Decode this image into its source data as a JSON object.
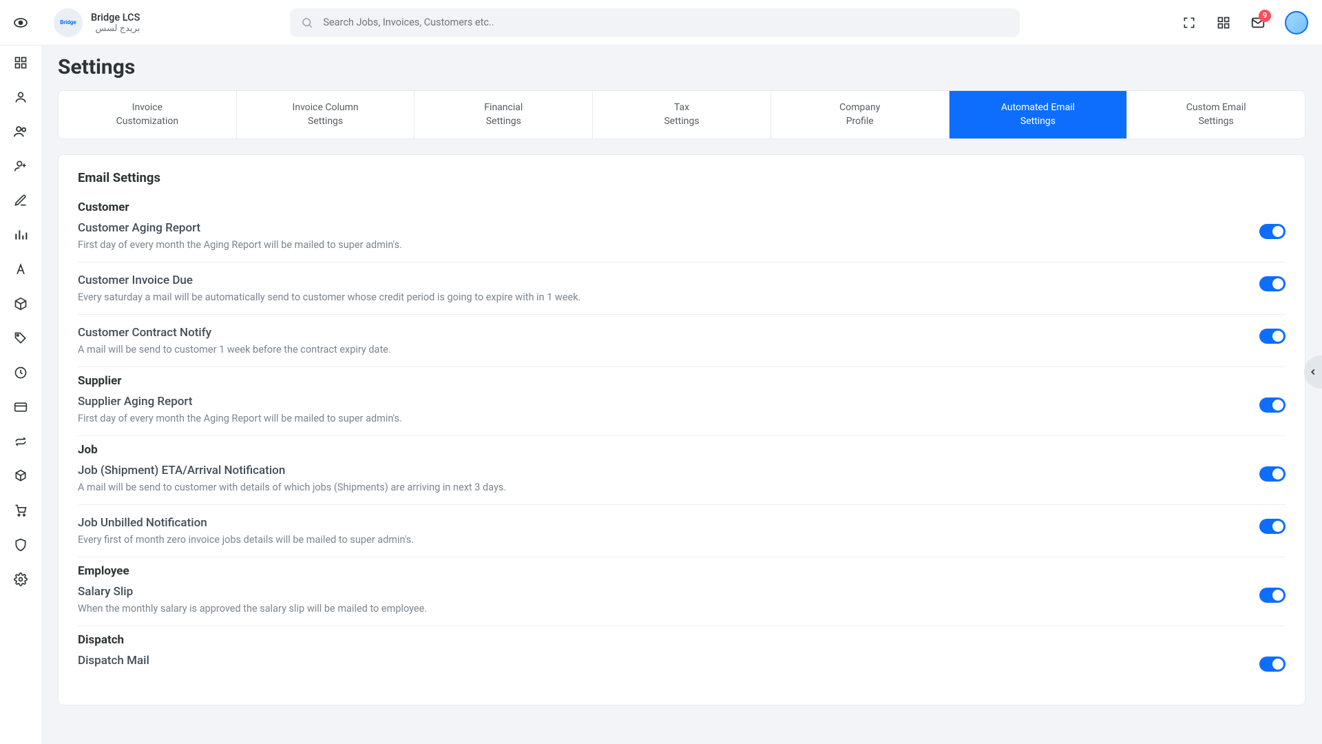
{
  "header": {
    "brand_name": "Bridge LCS",
    "brand_sub": "بريدج لسس",
    "search_placeholder": "Search Jobs, Invoices, Customers etc..",
    "notif_count": "9"
  },
  "page_title": "Settings",
  "tabs": [
    {
      "l1": "Invoice",
      "l2": "Customization"
    },
    {
      "l1": "Invoice Column",
      "l2": "Settings"
    },
    {
      "l1": "Financial",
      "l2": "Settings"
    },
    {
      "l1": "Tax",
      "l2": "Settings"
    },
    {
      "l1": "Company",
      "l2": "Profile"
    },
    {
      "l1": "Automated Email",
      "l2": "Settings"
    },
    {
      "l1": "Custom Email",
      "l2": "Settings"
    }
  ],
  "panel_title": "Email Settings",
  "groups": {
    "customer": {
      "heading": "Customer",
      "items": [
        {
          "title": "Customer Aging Report",
          "desc": "First day of every month the Aging Report will be mailed to super admin's."
        },
        {
          "title": "Customer Invoice Due",
          "desc": "Every saturday a mail will be automatically send to customer whose credit period is going to expire with in 1 week."
        },
        {
          "title": "Customer Contract Notify",
          "desc": "A mail will be send to customer 1 week before the contract expiry date."
        }
      ]
    },
    "supplier": {
      "heading": "Supplier",
      "items": [
        {
          "title": "Supplier Aging Report",
          "desc": "First day of every month the Aging Report will be mailed to super admin's."
        }
      ]
    },
    "job": {
      "heading": "Job",
      "items": [
        {
          "title": "Job (Shipment) ETA/Arrival Notification",
          "desc": "A mail will be send to customer with details of which jobs (Shipments) are arriving in next 3 days."
        },
        {
          "title": "Job Unbilled Notification",
          "desc": "Every first of month zero invoice jobs details will be mailed to super admin's."
        }
      ]
    },
    "employee": {
      "heading": "Employee",
      "items": [
        {
          "title": "Salary Slip",
          "desc": "When the monthly salary is approved the salary slip will be mailed to employee."
        }
      ]
    },
    "dispatch": {
      "heading": "Dispatch",
      "items": [
        {
          "title": "Dispatch Mail",
          "desc": ""
        }
      ]
    }
  }
}
